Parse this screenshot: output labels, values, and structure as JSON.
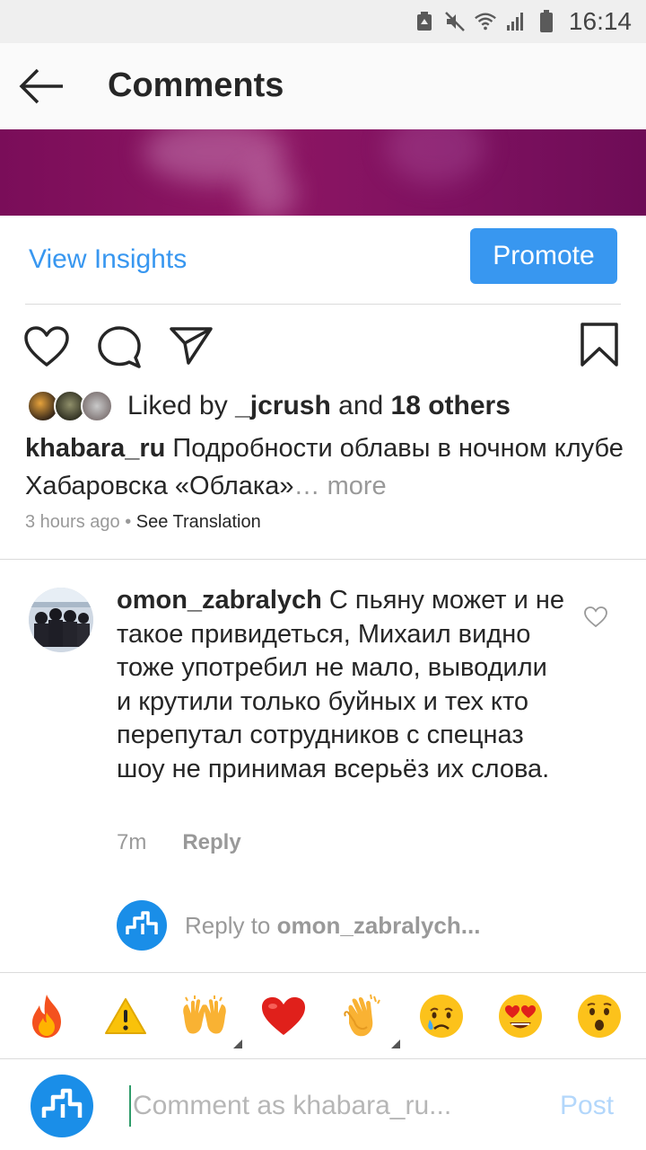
{
  "status_bar": {
    "time": "16:14",
    "icons": [
      "storage-icon",
      "mute-icon",
      "wifi-icon",
      "signal-icon",
      "battery-icon"
    ]
  },
  "header": {
    "title": "Comments",
    "back_icon": "back-arrow-icon"
  },
  "insights": {
    "view_label": "View Insights",
    "promote_label": "Promote"
  },
  "actions": {
    "icons": [
      "heart-icon",
      "comment-icon",
      "share-icon",
      "bookmark-icon"
    ]
  },
  "likes": {
    "prefix": "Liked by ",
    "user": "_jcrush",
    "middle": " and ",
    "others": "18 others"
  },
  "caption": {
    "username": "khabara_ru",
    "text": " Подробности облавы в ночном клубе Хабаровска «Облака»",
    "more": "… more"
  },
  "meta": {
    "time": "3 hours ago",
    "separator": " • ",
    "translate": "See Translation"
  },
  "comment": {
    "username": "omon_zabralych",
    "text": " С пьяну может и не такое привидеться, Михаил видно тоже употребил не мало, выводили и крутили только буйных и тех кто перепутал сотрудников с спецназ шоу не принимая всерьёз их слова.",
    "time": "7m",
    "reply_label": "Reply"
  },
  "reply_to": {
    "prefix": "Reply to ",
    "username": "omon_zabralych..."
  },
  "emojis": [
    "🔥",
    "⚠️",
    "🙌",
    "❤️",
    "👏",
    "😢",
    "😍",
    "😮"
  ],
  "input": {
    "placeholder": "Comment as khabara_ru...",
    "post_label": "Post"
  },
  "colors": {
    "accent": "#3897f0",
    "brand_logo": "#1a8ee8",
    "media": "#7e1160"
  }
}
